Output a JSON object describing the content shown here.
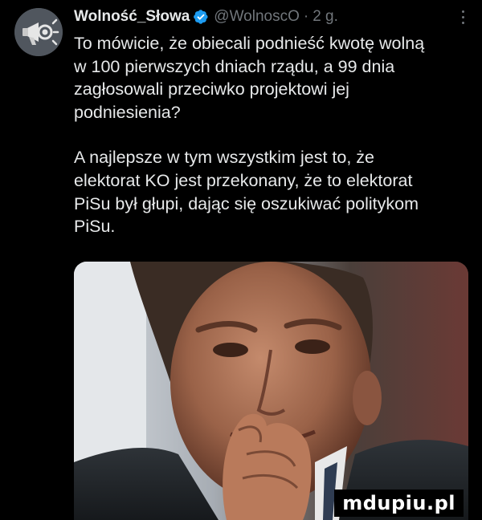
{
  "tweet": {
    "author": {
      "display_name": "Wolność_Słowa",
      "handle": "@WolnoscO",
      "separator": "·",
      "age": "2 g.",
      "verified": true,
      "avatar_icon": "megaphone-icon"
    },
    "paragraphs": [
      "To mówicie, że obiecali podnieść kwotę wolną\nw 100 pierwszych dniach rządu, a 99 dnia\nzagłosowali przeciwko projektowi jej\npodniesienia?",
      "A najlepsze w tym wszystkim jest to, że\nelektorat KO jest przekonany, że to elektorat\nPiSu był głupi, dając się oszukiwać politykom\nPiSu."
    ],
    "media": {
      "kind": "photo"
    }
  },
  "watermark": {
    "text": "mdupiu.pl"
  },
  "colors": {
    "background": "#000000",
    "text_primary": "#e7e9ea",
    "text_secondary": "#71767b",
    "verified_badge": "#1d9bf0"
  }
}
